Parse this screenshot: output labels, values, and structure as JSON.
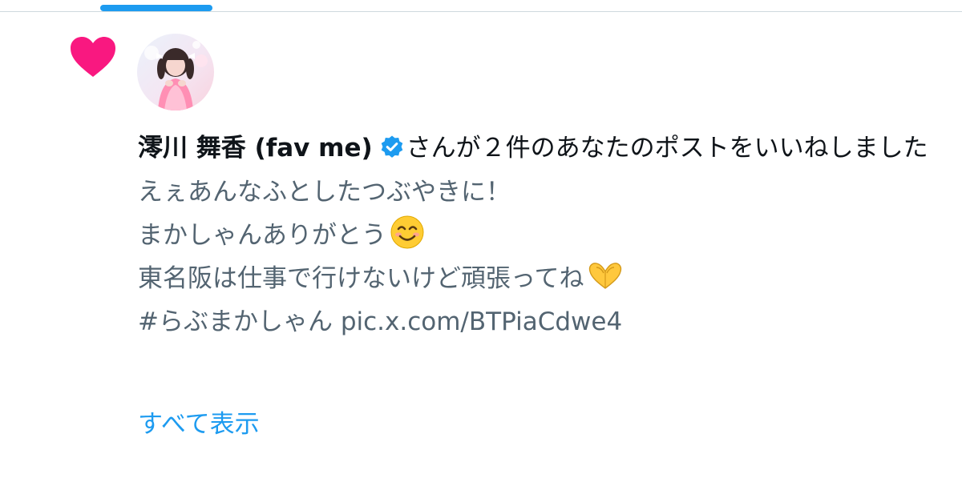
{
  "colors": {
    "accent": "#1d9bf0",
    "like_heart": "#f91880",
    "primary_text": "#0f1419",
    "secondary_text": "#536471",
    "divider": "#cfd9de",
    "verified_badge": "#1d9bf0"
  },
  "notification": {
    "icon": "heart-icon",
    "user": {
      "display_name": "澪川 舞香 (fav me)",
      "verified": true,
      "badge_icon": "verified-badge-icon",
      "avatar_icon": "avatar"
    },
    "action_text": "さんが２件のあなたのポストをいいねしました",
    "post": {
      "lines": [
        "えぇあんなふとしたつぶやきに！",
        "まかしゃんありがとう",
        "東名阪は仕事で行けないけど頑張ってね",
        "#らぶまかしゃん pic.x.com/BTPiaCdwe4"
      ],
      "emoji_line2": "smiling-face-emoji",
      "emoji_line3": "heart-hands-emoji"
    },
    "show_all_label": "すべて表示"
  }
}
